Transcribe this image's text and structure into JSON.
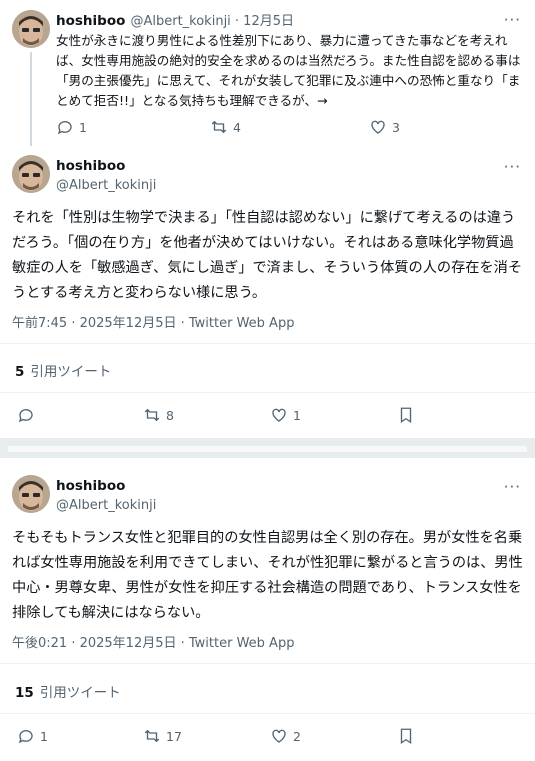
{
  "tweet1": {
    "display_name": "hoshiboo",
    "handle_date": "@Albert_kokinji · 12月5日",
    "text": "女性が永きに渡り男性による性差別下にあり、暴力に遭ってきた事などを考えれば、女性専用施設の絶対的安全を求めるのは当然だろう。また性自認を認める事は「男の主張優先」に思えて、それが女装して犯罪に及ぶ連中への恐怖と重なり「まとめて拒否!!」となる気持ちも理解できるが、→",
    "reply_count": "1",
    "retweet_count": "4",
    "like_count": "3"
  },
  "tweet2": {
    "display_name": "hoshiboo",
    "handle": "@Albert_kokinji",
    "text": "それを「性別は生物学で決まる」「性自認は認めない」に繋げて考えるのは違うだろう。「個の在り方」を他者が決めてはいけない。それはある意味化学物質過敏症の人を「敏感過ぎ、気にし過ぎ」で済まし、そういう体質の人の存在を消そうとする考え方と変わらない様に思う。",
    "meta": "午前7:45 · 2025年12月5日 · Twitter Web App",
    "quote_count": "5",
    "quote_label": "引用ツイート",
    "reply_count": "",
    "retweet_count": "8",
    "like_count": "1"
  },
  "tweet3": {
    "display_name": "hoshiboo",
    "handle": "@Albert_kokinji",
    "text": "そもそもトランス女性と犯罪目的の女性自認男は全く別の存在。男が女性を名乗れば女性専用施設を利用できてしまい、それが性犯罪に繋がると言うのは、男性中心・男尊女卑、男性が女性を抑圧する社会構造の問題であり、トランス女性を排除しても解決にはならない。",
    "meta": "午後0:21 · 2025年12月5日 · Twitter Web App",
    "quote_count": "15",
    "quote_label": "引用ツイート",
    "reply_count": "1",
    "retweet_count": "17",
    "like_count": "2"
  },
  "more_label": "···",
  "colors": {
    "text": "#0f1419",
    "secondary": "#536471",
    "divider": "#eff3f4"
  }
}
